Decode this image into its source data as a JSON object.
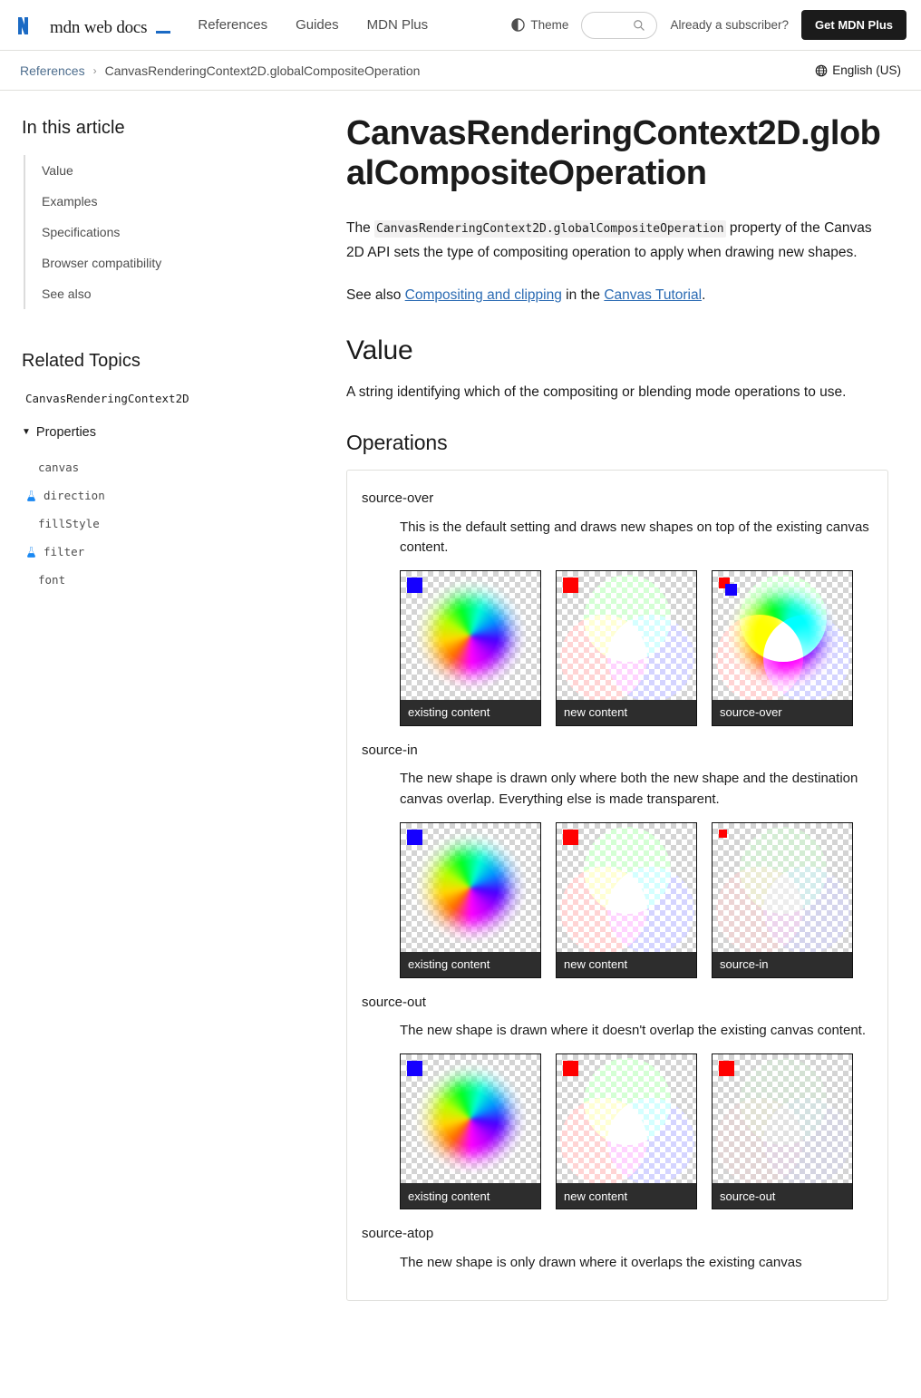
{
  "header": {
    "logo_text": "mdn web docs",
    "nav": [
      {
        "label": "References"
      },
      {
        "label": "Guides"
      },
      {
        "label": "MDN Plus"
      }
    ],
    "theme_label": "Theme",
    "search_placeholder": "",
    "search_value": "",
    "subscriber_text": "Already a subscriber?",
    "plus_button": "Get MDN Plus"
  },
  "breadcrumb": {
    "parent": "References",
    "separator": "›",
    "current": "CanvasRenderingContext2D.globalCompositeOperation",
    "language": "English (US)"
  },
  "sidebar": {
    "toc_title": "In this article",
    "toc": [
      {
        "label": "Value"
      },
      {
        "label": "Examples"
      },
      {
        "label": "Specifications"
      },
      {
        "label": "Browser compatibility"
      },
      {
        "label": "See also"
      }
    ],
    "related_title": "Related Topics",
    "related_root": "CanvasRenderingContext2D",
    "properties_group": "Properties",
    "caret": "▼",
    "properties": [
      {
        "label": "canvas",
        "experimental": false
      },
      {
        "label": "direction",
        "experimental": true
      },
      {
        "label": "fillStyle",
        "experimental": false
      },
      {
        "label": "filter",
        "experimental": true
      },
      {
        "label": "font",
        "experimental": false
      }
    ]
  },
  "article": {
    "title": "CanvasRenderingContext2D.globalCompositeOperation",
    "intro_before": "The ",
    "intro_code": "CanvasRenderingContext2D.globalCompositeOperation",
    "intro_after": " property of the Canvas 2D API sets the type of compositing operation to apply when drawing new shapes.",
    "seealso_before": "See also ",
    "seealso_link1": "Compositing and clipping",
    "seealso_mid": " in the ",
    "seealso_link2": "Canvas Tutorial",
    "seealso_after": ".",
    "value_heading": "Value",
    "value_text": "A string identifying which of the compositing or blending mode operations to use.",
    "operations_heading": "Operations",
    "operations": [
      {
        "term": "source-over",
        "description": "This is the default setting and draws new shapes on top of the existing canvas content.",
        "figures": [
          {
            "caption": "existing content"
          },
          {
            "caption": "new content"
          },
          {
            "caption": "source-over"
          }
        ]
      },
      {
        "term": "source-in",
        "description": "The new shape is drawn only where both the new shape and the destination canvas overlap. Everything else is made transparent.",
        "figures": [
          {
            "caption": "existing content"
          },
          {
            "caption": "new content"
          },
          {
            "caption": "source-in"
          }
        ]
      },
      {
        "term": "source-out",
        "description": "The new shape is drawn where it doesn't overlap the existing canvas content.",
        "figures": [
          {
            "caption": "existing content"
          },
          {
            "caption": "new content"
          },
          {
            "caption": "source-out"
          }
        ]
      },
      {
        "term": "source-atop",
        "description": "The new shape is only drawn where it overlaps the existing canvas"
      }
    ]
  }
}
